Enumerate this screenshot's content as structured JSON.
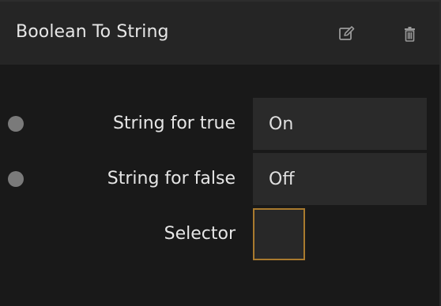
{
  "node": {
    "title": "Boolean To String",
    "edit_icon": "edit-icon",
    "delete_icon": "trash-icon"
  },
  "fields": {
    "true_label": "String for true",
    "true_value": "On",
    "false_label": "String for false",
    "false_value": "Off",
    "selector_label": "Selector"
  },
  "colors": {
    "header_bg": "#252525",
    "body_bg": "#191919",
    "field_bg": "#2a2a2a",
    "port": "#7a7a7a",
    "selector_border": "#a97a2e",
    "text": "#e6e6e6"
  }
}
